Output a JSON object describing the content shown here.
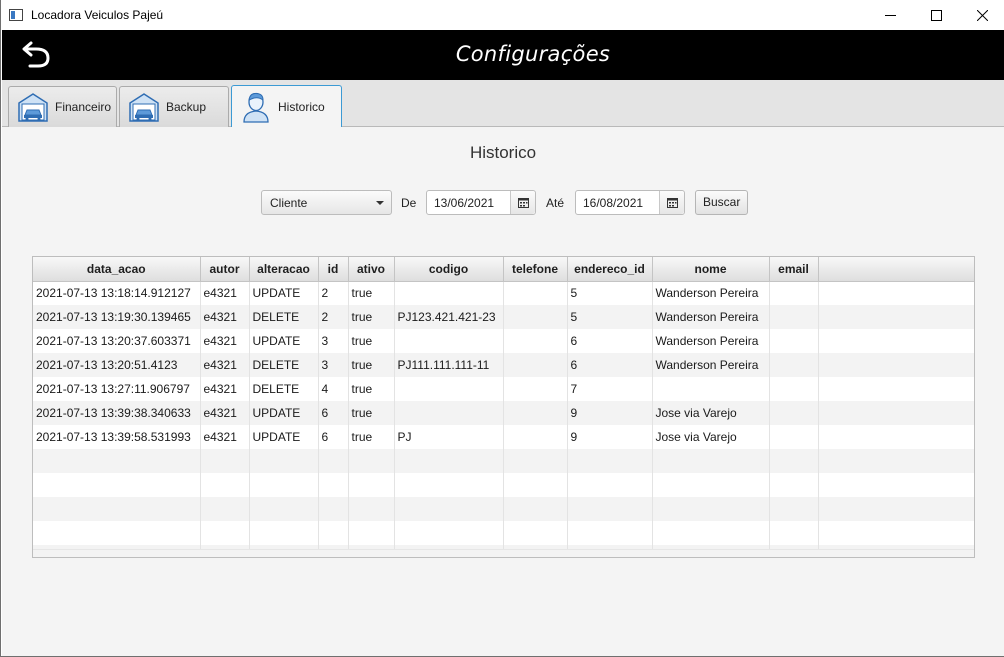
{
  "window": {
    "title": "Locadora Veiculos Pajeú",
    "icon": "window-app-icon"
  },
  "header": {
    "title": "Configurações",
    "back_icon": "back-arrow-icon"
  },
  "tabs": [
    {
      "label": "Financeiro",
      "icon": "garage-car-icon",
      "active": false
    },
    {
      "label": "Backup",
      "icon": "garage-car-icon",
      "active": false
    },
    {
      "label": "Historico",
      "icon": "user-icon",
      "active": true
    }
  ],
  "main": {
    "section_title": "Historico",
    "filters": {
      "entity_select": "Cliente",
      "from_label": "De",
      "from_date": "13/06/2021",
      "to_label": "Até",
      "to_date": "16/08/2021",
      "search_button": "Buscar"
    },
    "table": {
      "columns": [
        "data_acao",
        "autor",
        "alteracao",
        "id",
        "ativo",
        "codigo",
        "telefone",
        "endereco_id",
        "nome",
        "email"
      ],
      "rows": [
        [
          "2021-07-13 13:18:14.912127",
          "e4321",
          "UPDATE",
          "2",
          "true",
          "",
          "",
          "5",
          "Wanderson Pereira",
          ""
        ],
        [
          "2021-07-13 13:19:30.139465",
          "e4321",
          "DELETE",
          "2",
          "true",
          "PJ123.421.421-23",
          "",
          "5",
          "Wanderson Pereira",
          ""
        ],
        [
          "2021-07-13 13:20:37.603371",
          "e4321",
          "UPDATE",
          "3",
          "true",
          "",
          "",
          "6",
          "Wanderson Pereira",
          ""
        ],
        [
          "2021-07-13 13:20:51.4123",
          "e4321",
          "DELETE",
          "3",
          "true",
          "PJ111.111.111-11",
          "",
          "6",
          "Wanderson Pereira",
          ""
        ],
        [
          "2021-07-13 13:27:11.906797",
          "e4321",
          "DELETE",
          "4",
          "true",
          "",
          "",
          "7",
          "",
          ""
        ],
        [
          "2021-07-13 13:39:38.340633",
          "e4321",
          "UPDATE",
          "6",
          "true",
          "",
          "",
          "9",
          "Jose via Varejo",
          ""
        ],
        [
          "2021-07-13 13:39:58.531993",
          "e4321",
          "UPDATE",
          "6",
          "true",
          "PJ",
          "",
          "9",
          "Jose via Varejo",
          ""
        ]
      ]
    }
  },
  "colors": {
    "header_bg": "#000000",
    "accent": "#3c9ad4",
    "icon_blue": "#3a78c2"
  }
}
